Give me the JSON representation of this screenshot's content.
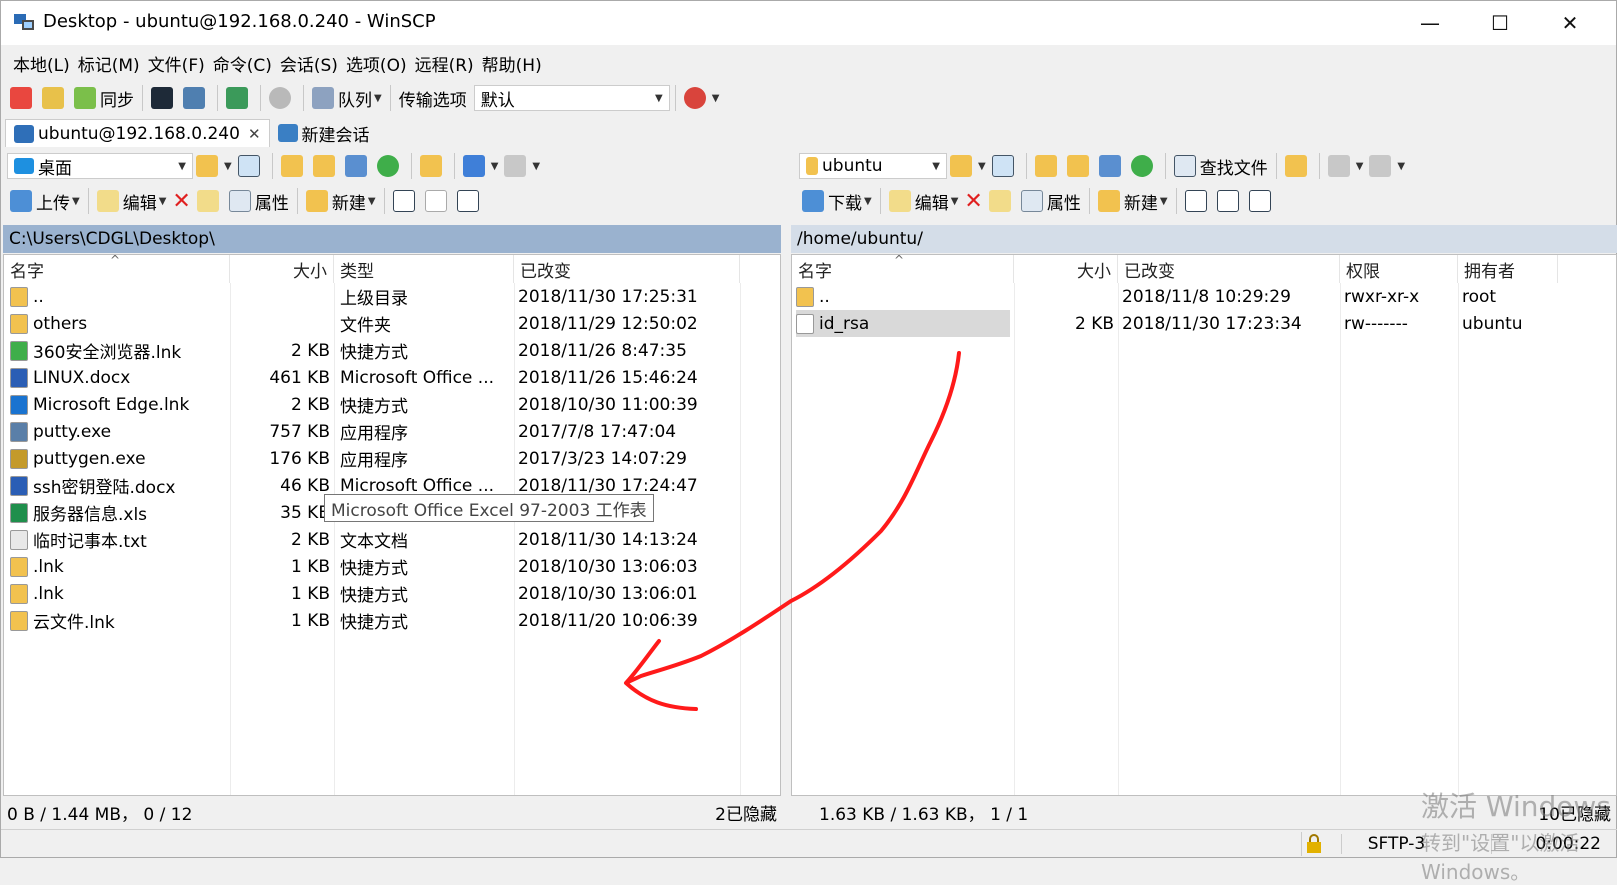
{
  "window": {
    "title": "Desktop - ubuntu@192.168.0.240 - WinSCP"
  },
  "menu": [
    "本地(L)",
    "标记(M)",
    "文件(F)",
    "命令(C)",
    "会话(S)",
    "选项(O)",
    "远程(R)",
    "帮助(H)"
  ],
  "toolbar": {
    "sync_label": "同步",
    "queue_label": "队列",
    "transfer_options_label": "传输选项",
    "transfer_preset": "默认"
  },
  "tabs": [
    {
      "label": "ubuntu@192.168.0.240"
    },
    {
      "label": "新建会话"
    }
  ],
  "local": {
    "location": "桌面",
    "path": "C:\\Users\\CDGL\\Desktop\\",
    "actions": {
      "upload": "上传",
      "edit": "编辑",
      "properties": "属性",
      "new": "新建"
    },
    "columns": [
      "名字",
      "大小",
      "类型",
      "已改变"
    ],
    "files": [
      {
        "name": "..",
        "size": "",
        "type": "上级目录",
        "changed": "2018/11/30  17:25:31",
        "icon": "up-folder"
      },
      {
        "name": "others",
        "size": "",
        "type": "文件夹",
        "changed": "2018/11/29  12:50:02",
        "icon": "folder"
      },
      {
        "name": "360安全浏览器.lnk",
        "size": "2 KB",
        "type": "快捷方式",
        "changed": "2018/11/26  8:47:35",
        "icon": "browser-shortcut"
      },
      {
        "name": "LINUX.docx",
        "size": "461 KB",
        "type": "Microsoft Office ...",
        "changed": "2018/11/26  15:46:24",
        "icon": "word-doc"
      },
      {
        "name": "Microsoft Edge.lnk",
        "size": "2 KB",
        "type": "快捷方式",
        "changed": "2018/10/30  11:00:39",
        "icon": "edge-shortcut"
      },
      {
        "name": "putty.exe",
        "size": "757 KB",
        "type": "应用程序",
        "changed": "2017/7/8  17:47:04",
        "icon": "putty"
      },
      {
        "name": "puttygen.exe",
        "size": "176 KB",
        "type": "应用程序",
        "changed": "2017/3/23  14:07:29",
        "icon": "puttygen"
      },
      {
        "name": "ssh密钥登陆.docx",
        "size": "46 KB",
        "type": "Microsoft Office ...",
        "changed": "2018/11/30  17:24:47",
        "icon": "word-doc"
      },
      {
        "name": "服务器信息.xls",
        "size": "35 KB",
        "type": "",
        "changed": "3:36",
        "icon": "excel-doc"
      },
      {
        "name": "临时记事本.txt",
        "size": "2 KB",
        "type": "文本文档",
        "changed": "2018/11/30  14:13:24",
        "icon": "text-file"
      },
      {
        "name": ".lnk",
        "size": "1 KB",
        "type": "快捷方式",
        "changed": "2018/10/30  13:06:03",
        "icon": "folder-shortcut"
      },
      {
        "name": ".lnk",
        "size": "1 KB",
        "type": "快捷方式",
        "changed": "2018/10/30  13:06:01",
        "icon": "folder-shortcut"
      },
      {
        "name": "云文件.lnk",
        "size": "1 KB",
        "type": "快捷方式",
        "changed": "2018/11/20  10:06:39",
        "icon": "folder-shortcut"
      }
    ],
    "tooltip": "Microsoft Office Excel 97-2003 工作表",
    "status_left": "0 B / 1.44 MB， 0 / 12",
    "status_right": "2已隐藏"
  },
  "remote": {
    "location": "ubuntu",
    "find_files_label": "查找文件",
    "path": "/home/ubuntu/",
    "actions": {
      "download": "下载",
      "edit": "编辑",
      "properties": "属性",
      "new": "新建"
    },
    "columns": [
      "名字",
      "大小",
      "已改变",
      "权限",
      "拥有者"
    ],
    "files": [
      {
        "name": "..",
        "size": "",
        "changed": "2018/11/8 10:29:29",
        "rights": "rwxr-xr-x",
        "owner": "root",
        "icon": "up-folder"
      },
      {
        "name": "id_rsa",
        "size": "2 KB",
        "changed": "2018/11/30 17:23:34",
        "rights": "rw-------",
        "owner": "ubuntu",
        "icon": "file"
      }
    ],
    "status_left": "1.63 KB / 1.63 KB， 1 / 1",
    "status_right": "10已隐藏"
  },
  "bottom_status": {
    "protocol": "SFTP-3",
    "elapsed": "0:00:22"
  },
  "watermark": {
    "line1": "激活 Windows",
    "line2": "转到\"设置\"以激活 Windows。"
  },
  "colors": {
    "local_path_bg": "#9ab2cf",
    "remote_path_bg": "#d4dde8",
    "selection": "#d9d9d9",
    "annotation": "#ff1a1a"
  }
}
